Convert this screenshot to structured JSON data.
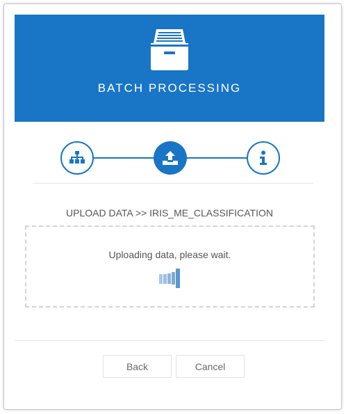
{
  "header": {
    "title": "BATCH PROCESSING",
    "icon": "archive-drawer-icon",
    "background": "#1975c5"
  },
  "steps": [
    {
      "icon": "hierarchy-icon",
      "state": "done"
    },
    {
      "icon": "upload-icon",
      "state": "active"
    },
    {
      "icon": "info-icon",
      "state": "pending"
    }
  ],
  "upload": {
    "path": "UPLOAD DATA >> IRIS_ME_CLASSIFICATION",
    "message": "Uploading data, please wait."
  },
  "buttons": {
    "back": "Back",
    "cancel": "Cancel"
  },
  "colors": {
    "accent": "#1975c5",
    "text": "#555555"
  }
}
